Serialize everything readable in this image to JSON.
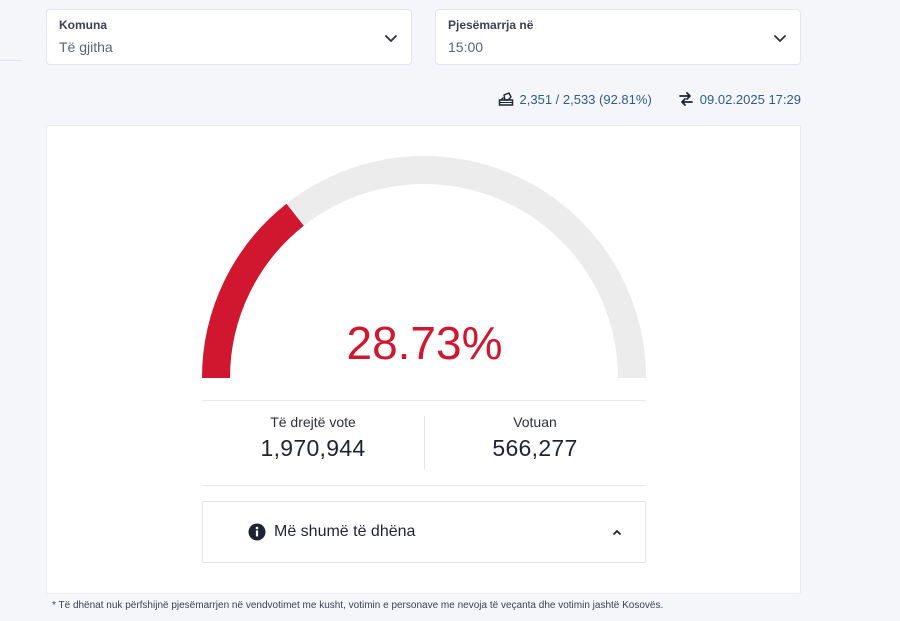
{
  "filters": {
    "komuna": {
      "label": "Komuna",
      "value": "Të gjitha"
    },
    "pjesemarrja": {
      "label": "Pjesëmarrja në",
      "value": "15:00"
    }
  },
  "info": {
    "stations": "2,351 / 2,533 (92.81%)",
    "updated": "09.02.2025 17:29"
  },
  "gauge": {
    "percent_label": "28.73%",
    "percent_value": 28.73,
    "fill_color": "#d0172f",
    "track_color": "#ececec"
  },
  "stats": {
    "eligible": {
      "label": "Të drejtë vote",
      "value": "1,970,944"
    },
    "voted": {
      "label": "Votuan",
      "value": "566,277"
    }
  },
  "more": {
    "label": "Më shumë të dhëna"
  },
  "footnote": "* Të dhënat nuk përfshijnë pjesëmarrjen në vendvotimet me kusht, votimin e personave me nevoja të veçanta dhe votimin jashtë Kosovës."
}
